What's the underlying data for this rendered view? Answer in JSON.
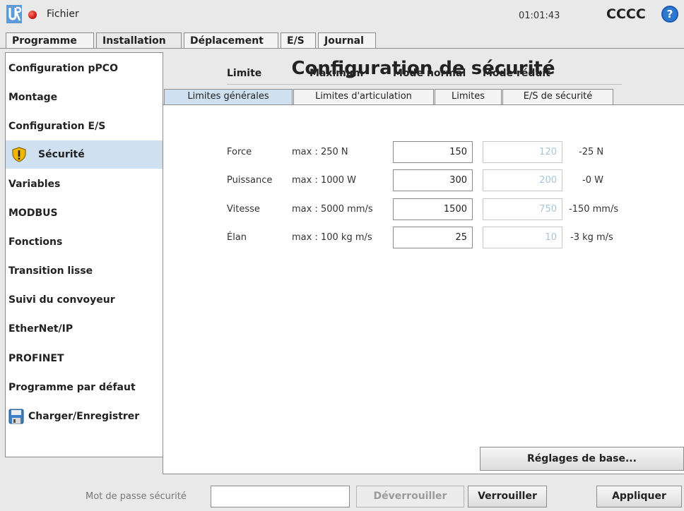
{
  "topbar": {
    "file_label": "Fichier",
    "clock": "01:01:43",
    "robot_name": "CCCC",
    "help_symbol": "?"
  },
  "main_tabs": [
    "Programme",
    "Installation",
    "Déplacement",
    "E/S",
    "Journal"
  ],
  "main_tab_active": "Installation",
  "sidebar": {
    "items": [
      {
        "label": "Configuration pPCO"
      },
      {
        "label": "Montage"
      },
      {
        "label": "Configuration E/S"
      },
      {
        "label": "Sécurité",
        "icon": "warning-shield-icon",
        "active": true
      },
      {
        "label": "Variables"
      },
      {
        "label": "MODBUS"
      },
      {
        "label": "Fonctions"
      },
      {
        "label": "Transition lisse"
      },
      {
        "label": "Suivi du convoyeur"
      },
      {
        "label": "EtherNet/IP"
      },
      {
        "label": "PROFINET"
      },
      {
        "label": "Programme par défaut"
      },
      {
        "label": "Charger/Enregistrer",
        "icon": "floppy-disk-icon"
      }
    ]
  },
  "page_title": "Configuration de sécurité",
  "sub_tabs": [
    "Limites générales",
    "Limites d'articulation",
    "Limites",
    "E/S de sécurité"
  ],
  "sub_tab_active": "Limites générales",
  "table": {
    "headers": [
      "Limite",
      "Maximum",
      "Mode normal",
      "Mode réduit"
    ],
    "rows": [
      {
        "name": "Force",
        "max": "max : 250 N",
        "normal": "150",
        "reduced": "120",
        "delta": "-25 N"
      },
      {
        "name": "Puissance",
        "max": "max : 1000 W",
        "normal": "300",
        "reduced": "200",
        "delta": "-0 W"
      },
      {
        "name": "Vitesse",
        "max": "max : 5000 mm/s",
        "normal": "1500",
        "reduced": "750",
        "delta": "-150 mm/s"
      },
      {
        "name": "Élan",
        "max": "max : 100 kg m/s",
        "normal": "25",
        "reduced": "10",
        "delta": "-3 kg m/s"
      }
    ]
  },
  "base_settings_button": "Réglages de base...",
  "footer": {
    "password_label": "Mot de passe sécurité",
    "password_value": "",
    "unlock_button": "Déverrouiller",
    "lock_button": "Verrouiller",
    "apply_button": "Appliquer"
  },
  "colors": {
    "active_tab": "#cfe0f1",
    "status_dot": "#d2231a",
    "help": "#2e78d1",
    "warning": "#f2b705"
  }
}
